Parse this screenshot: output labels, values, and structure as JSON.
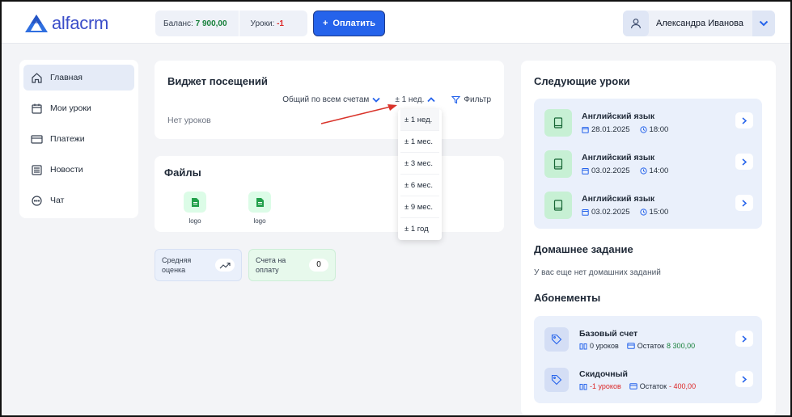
{
  "header": {
    "logo_text": "alfacrm",
    "balance_label": "Баланс:",
    "balance_value": "7 900,00",
    "lessons_label": "Уроки:",
    "lessons_value": "-1",
    "pay_button": "Оплатить",
    "pay_icon": "plus-icon",
    "user_name": "Александра Иванова"
  },
  "sidebar": {
    "items": [
      {
        "label": "Главная",
        "icon": "home-icon",
        "active": true
      },
      {
        "label": "Мои уроки",
        "icon": "calendar-icon"
      },
      {
        "label": "Платежи",
        "icon": "card-icon"
      },
      {
        "label": "Новости",
        "icon": "newspaper-icon"
      },
      {
        "label": "Чат",
        "icon": "chat-icon"
      }
    ]
  },
  "attendance_widget": {
    "title": "Виджет посещений",
    "account_filter": "Общий по всем счетам",
    "period": "± 1 нед.",
    "filter_label": "Фильтр",
    "empty_text": "Нет уроков",
    "period_options": [
      "± 1 нед.",
      "± 1 мес.",
      "± 3 мес.",
      "± 6 мес.",
      "± 9 мес.",
      "± 1 год"
    ]
  },
  "files": {
    "title": "Файлы",
    "items": [
      {
        "label": "logo"
      },
      {
        "label": "logo"
      }
    ]
  },
  "stats": {
    "avg_label_1": "Средняя",
    "avg_label_2": "оценка",
    "invoices_label_1": "Счета на",
    "invoices_label_2": "оплату",
    "invoices_value": "0"
  },
  "next_lessons": {
    "title": "Следующие уроки",
    "items": [
      {
        "name": "Английский язык",
        "date": "28.01.2025",
        "time": "18:00"
      },
      {
        "name": "Английский язык",
        "date": "03.02.2025",
        "time": "14:00"
      },
      {
        "name": "Английский язык",
        "date": "03.02.2025",
        "time": "15:00"
      }
    ]
  },
  "homework": {
    "title": "Домашнее задание",
    "empty_text": "У вас еще нет домашних заданий"
  },
  "subscriptions": {
    "title": "Абонементы",
    "items": [
      {
        "name": "Базовый счет",
        "lessons": "0 уроков",
        "balance_label": "Остаток",
        "balance_value": "8 300,00"
      },
      {
        "name": "Скидочный",
        "lessons": "-1 уроков",
        "balance_label": "Остаток",
        "balance_value": "- 400,00"
      }
    ]
  },
  "colors": {
    "accent": "#2563eb",
    "positive": "#16803a",
    "negative": "#dc2626",
    "annotation_arrow": "#d9342b"
  }
}
